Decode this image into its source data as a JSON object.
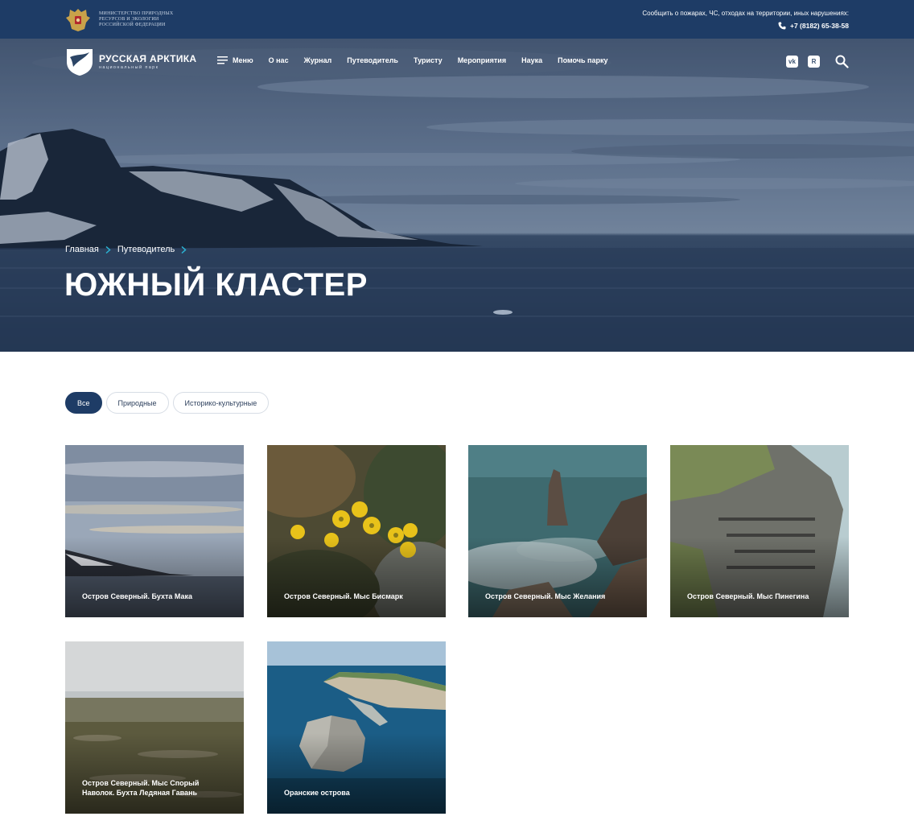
{
  "topbar": {
    "ministry": "Министерство природных ресурсов и экологии Российской Федерации",
    "report_text": "Сообщить о пожарах, ЧС, отходах на территории, иных нарушениях:",
    "phone": "+7 (8182) 65-38-58"
  },
  "logo": {
    "title": "РУССКАЯ АРКТИКА",
    "subtitle": "национальный парк"
  },
  "nav": {
    "items": [
      "Меню",
      "О нас",
      "Журнал",
      "Путеводитель",
      "Туристу",
      "Мероприятия",
      "Наука",
      "Помочь парку"
    ]
  },
  "socials": {
    "vk": "vk",
    "rutube": "R"
  },
  "breadcrumb": [
    "Главная",
    "Путеводитель"
  ],
  "page_title": "ЮЖНЫЙ КЛАСТЕР",
  "filters": {
    "items": [
      "Все",
      "Природные",
      "Историко-культурные"
    ],
    "selected": "Все"
  },
  "cards": [
    {
      "title": "Остров Северный. Бухта Мака"
    },
    {
      "title": "Остров Северный. Мыс Бисмарк"
    },
    {
      "title": "Остров Северный. Мыс Желания"
    },
    {
      "title": "Остров Северный. Мыс Пинегина"
    },
    {
      "title": "Остров Северный. Мыс Спорый Наволок. Бухта Ледяная Гавань"
    },
    {
      "title": "Оранские острова"
    }
  ],
  "colors": {
    "primary": "#1e3c66",
    "accent": "#2bb3d4",
    "white": "#ffffff"
  }
}
